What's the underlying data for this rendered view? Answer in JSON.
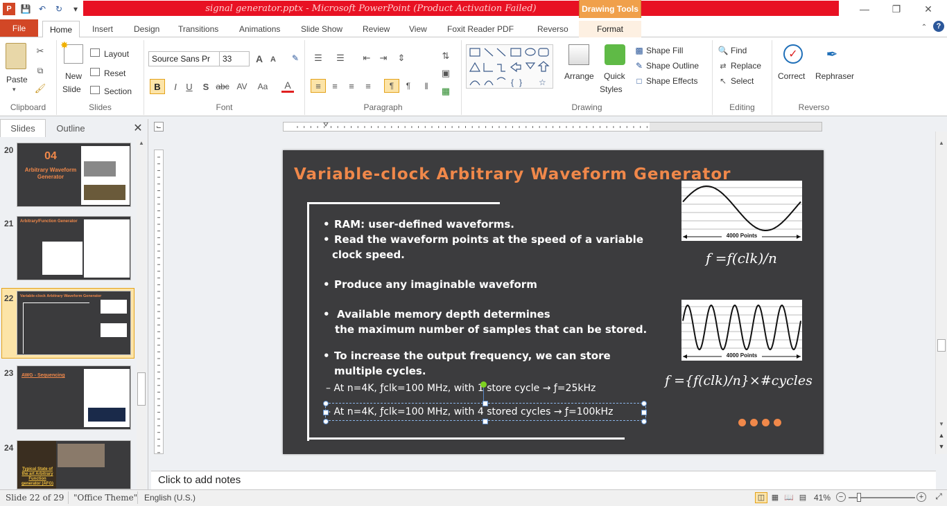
{
  "window": {
    "title": "signal generator.pptx - Microsoft PowerPoint (Product Activation Failed)",
    "contextual_tab_group": "Drawing Tools"
  },
  "tabs": [
    "File",
    "Home",
    "Insert",
    "Design",
    "Transitions",
    "Animations",
    "Slide Show",
    "Review",
    "View",
    "Foxit Reader PDF",
    "Reverso",
    "Format"
  ],
  "ribbon": {
    "clipboard": {
      "paste": "Paste",
      "label": "Clipboard"
    },
    "slides": {
      "new_slide_1": "New",
      "new_slide_2": "Slide",
      "layout": "Layout",
      "reset": "Reset",
      "section": "Section",
      "label": "Slides"
    },
    "font": {
      "family": "Source Sans Pr",
      "size": "33",
      "label": "Font"
    },
    "paragraph": {
      "label": "Paragraph"
    },
    "drawing": {
      "arrange": "Arrange",
      "quick_1": "Quick",
      "quick_2": "Styles",
      "shape_fill": "Shape Fill",
      "shape_outline": "Shape Outline",
      "shape_effects": "Shape Effects",
      "label": "Drawing"
    },
    "editing": {
      "find": "Find",
      "replace": "Replace",
      "select": "Select",
      "label": "Editing"
    },
    "reverso": {
      "correct": "Correct",
      "rephraser": "Rephraser",
      "label": "Reverso"
    }
  },
  "pane_tabs": {
    "slides": "Slides",
    "outline": "Outline"
  },
  "thumbnails": [
    {
      "num": "20",
      "title": "04",
      "subtitle": "Arbitrary Waveform Generator"
    },
    {
      "num": "21",
      "title": "Arbitrary/Function  Generator"
    },
    {
      "num": "22",
      "title": "Variable-clock  Arbitrary  Waveform  Generator"
    },
    {
      "num": "23",
      "title": "AWG - Sequencing"
    },
    {
      "num": "24",
      "title": "Typical State of the art Arbitrary Function generator (AFG)"
    }
  ],
  "slide": {
    "title": "Variable-clock  Arbitrary  Waveform  Generator",
    "bullet1": "RAM: user-defined waveforms.",
    "bullet2a": "Read the waveform points at the speed of a variable",
    "bullet2b": "clock speed.",
    "bullet3": "Produce any imaginable waveform",
    "bullet4a": "Available memory depth determines",
    "bullet4b": "the maximum number of samples that can be stored.",
    "bullet5a": "To  increase  the  output  frequency,  we  can  store",
    "bullet5b": "multiple cycles.",
    "sub1": "– At n=4K, ƒclk=100 MHz, with 1 store cycle → ƒ=25kHz",
    "sub2": "– At n=4K, ƒclk=100 MHz, with 4 stored cycles  →  ƒ=100kHz",
    "wave1_label": "4000 Points",
    "wave2_label": "4000 Points",
    "formula1": "f =f(clk)/n",
    "formula2": "f ={f(clk)/n}×#cycles"
  },
  "notes_placeholder": "Click to add notes",
  "status": {
    "slide": "Slide 22 of 29",
    "theme": "\"Office Theme\"",
    "language": "English (U.S.)",
    "zoom": "41%"
  },
  "colors": {
    "accent": "#f0884a",
    "file_tab": "#d24726",
    "title_bar_red": "#e81123",
    "slide_bg": "#3c3c3e"
  }
}
